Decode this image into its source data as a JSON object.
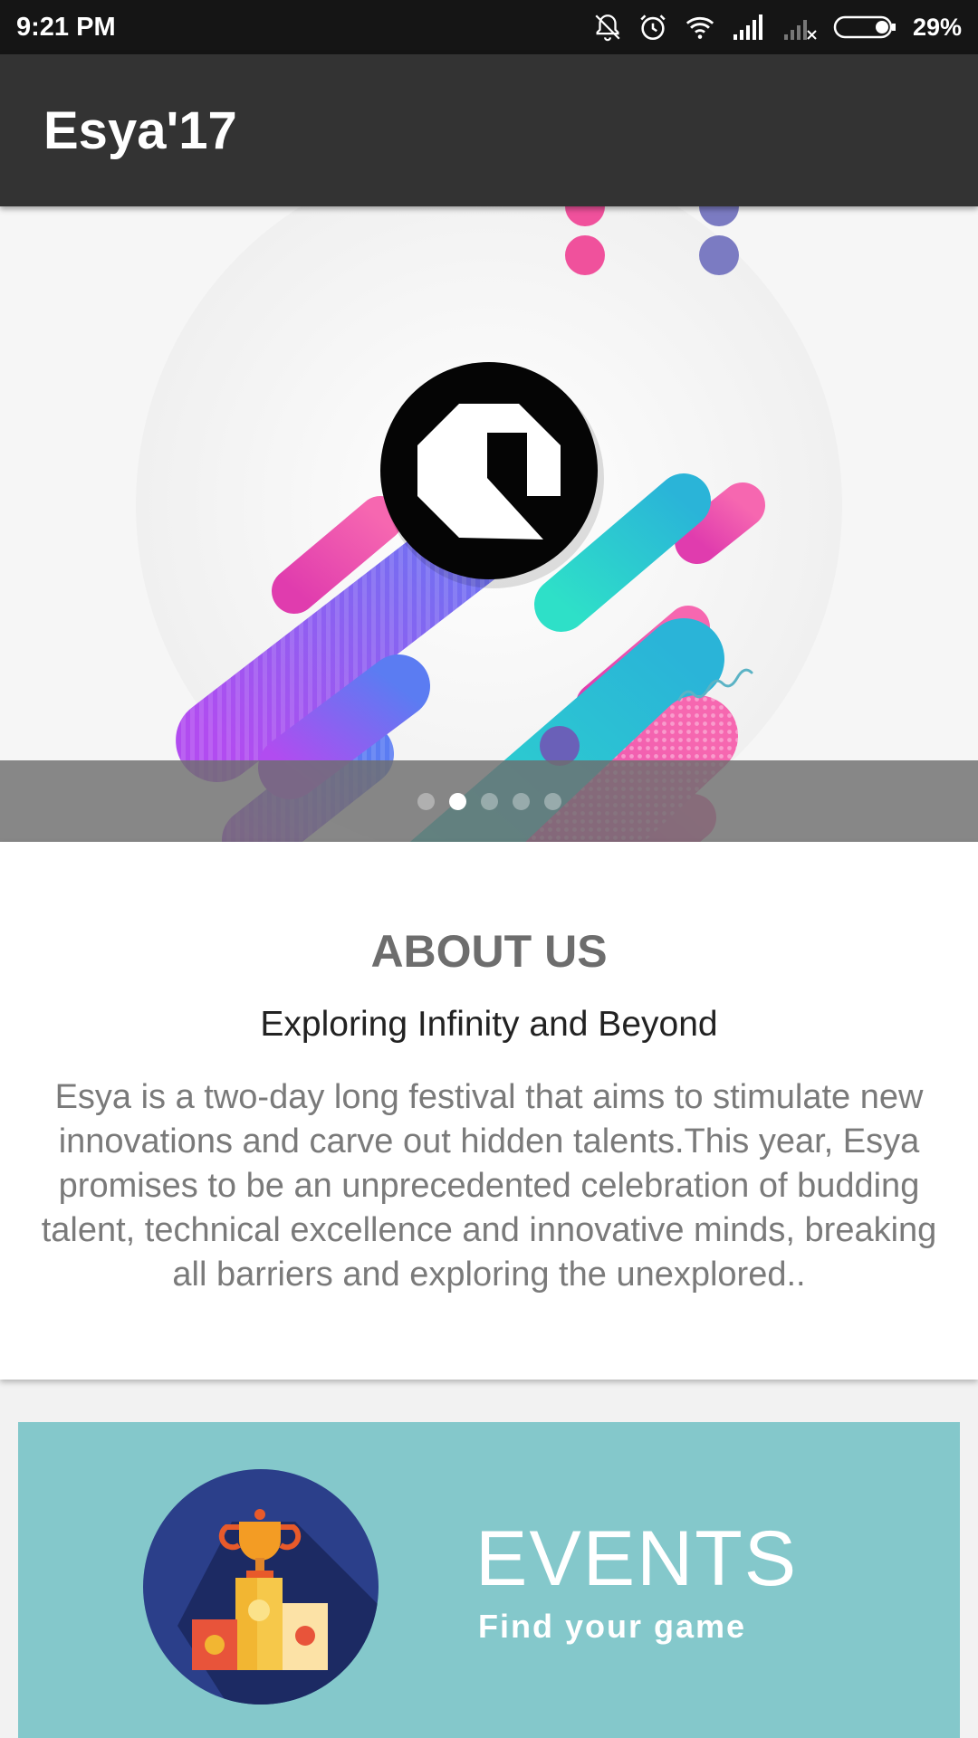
{
  "status_bar": {
    "time": "9:21 PM",
    "battery_percent": "29%",
    "icons": [
      "bell-off-icon",
      "alarm-icon",
      "wifi-icon",
      "signal-icon",
      "signal-no-sim-icon",
      "battery-icon"
    ]
  },
  "app_bar": {
    "title": "Esya'17"
  },
  "carousel": {
    "slide_count": 5,
    "active_index": 1,
    "logo": "esya-logo"
  },
  "about": {
    "title": "ABOUT US",
    "subtitle": "Exploring Infinity and Beyond",
    "body": "Esya is a two-day long festival that aims to stimulate new innovations and carve out hidden talents.This year, Esya promises to be an unprecedented celebration of budding talent, technical excellence and innovative minds, breaking all barriers and exploring the unexplored.."
  },
  "events": {
    "title": "EVENTS",
    "subtitle": "Find your game",
    "icon": "trophy-podium-icon"
  },
  "colors": {
    "status_bar_bg": "#151515",
    "app_bar_bg": "#333333",
    "events_bg": "#84c8cb",
    "about_title": "#6d6d6d"
  }
}
